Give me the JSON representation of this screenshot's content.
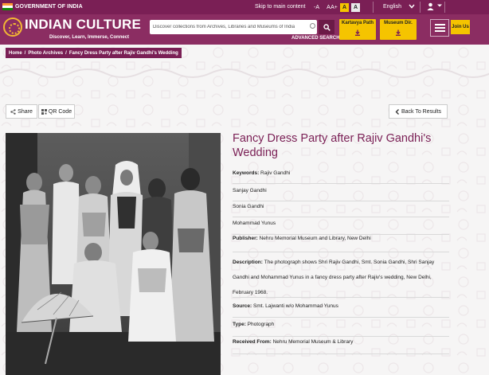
{
  "topbar": {
    "gov_label": "GOVERNMENT OF INDIA",
    "skip_label": "Skip to main content",
    "font_small": "-A",
    "font_normal": "A",
    "font_large": "A+",
    "contrast_yellow": "A",
    "contrast_white": "A",
    "language": "English"
  },
  "header": {
    "logo_title": "INDIAN CULTURE",
    "logo_subtitle": "Discover, Learn, Immerse, Connect",
    "search_placeholder": "Discover collections from Archives, Libraries and Museums of India",
    "advanced_search": "ADVANCED SEARCH",
    "kartavya_path": "Kartavya Path",
    "museum_dir": "Museum Dir.",
    "join_us": "Join Us"
  },
  "breadcrumb": {
    "items": [
      "Home",
      "Photo Archives",
      "Fancy Dress Party after Rajiv Gandhi's Wedding"
    ]
  },
  "actions": {
    "share": "Share",
    "qr_code": "QR Code",
    "back": "Back To Results"
  },
  "record": {
    "title": "Fancy Dress Party after Rajiv Gandhi's Wedding",
    "keywords_label": "Keywords:",
    "keywords": [
      "Rajiv Gandhi",
      "Sanjay Gandhi",
      "Sonia Gandhi",
      "Mohammad Yunus"
    ],
    "publisher_label": "Publisher:",
    "publisher": "Nehru Memorial Museum and Library, New Delhi",
    "description_label": "Description:",
    "description": "The photograph shows Shri Rajiv Gandhi, Smt. Sonia Gandhi, Shri Sanjay Gandhi and Mohammad Yunus in a fancy dress party after Rajiv's wedding, New Delhi, February 1968.",
    "source_label": "Source:",
    "source": "Smt. Lajwanti w/o Mohammad Yunus",
    "type_label": "Type:",
    "type": "Photograph",
    "received_label": "Received From:",
    "received": "Nehru Memorial Museum & Library"
  },
  "colors": {
    "brand_dark": "#7a1f55",
    "brand": "#8b2d62",
    "accent_yellow": "#f5c400",
    "title": "#7a1f55"
  }
}
